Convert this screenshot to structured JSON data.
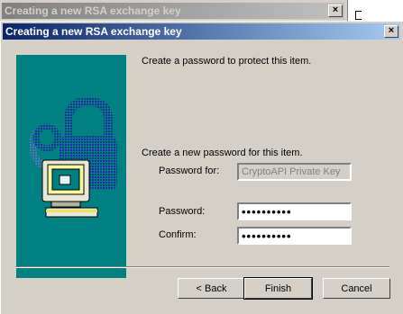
{
  "background_window": {
    "title": "Creating a new RSA exchange key",
    "close_glyph": "×"
  },
  "dialog": {
    "title": "Creating a new RSA exchange key",
    "close_glyph": "×",
    "illustration_icon": "computer-with-padlock-icon",
    "intro_text": "Create a password to protect this item.",
    "new_password_prompt": "Create a new password for this item.",
    "password_for_label": "Password for:",
    "password_for_value": "CryptoAPI Private Key",
    "password_label": "Password:",
    "password_value": "••••••••••",
    "confirm_label": "Confirm:",
    "confirm_value": "••••••••••",
    "buttons": {
      "back": "< Back",
      "finish": "Finish",
      "cancel": "Cancel"
    }
  },
  "colors": {
    "titlebar_active_start": "#0a246a",
    "titlebar_active_end": "#a6caf0",
    "titlebar_inactive": "#808080",
    "dialog_face": "#d4d0c8",
    "illustration_bg": "#008080"
  }
}
